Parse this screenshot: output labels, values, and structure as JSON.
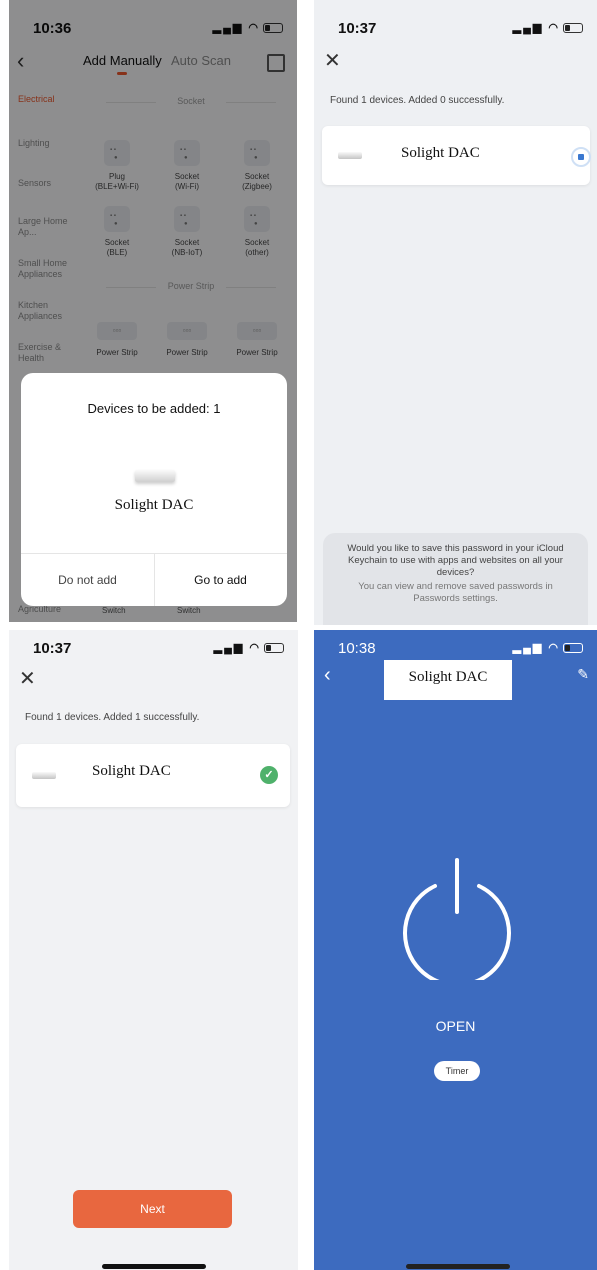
{
  "panel1": {
    "time": "10:36",
    "tabs": {
      "manual": "Add Manually",
      "auto": "Auto Scan"
    },
    "categories": [
      "Electrical",
      "Lighting",
      "Sensors",
      "Large Home Ap...",
      "Small Home Appliances",
      "Kitchen Appliances",
      "Exercise & Health",
      "Agriculture"
    ],
    "sections": {
      "socket": "Socket",
      "power_strip": "Power Strip"
    },
    "devices": [
      {
        "label": "Plug\n(BLE+Wi-Fi)"
      },
      {
        "label": "Socket\n(Wi-Fi)"
      },
      {
        "label": "Socket\n(Zigbee)"
      },
      {
        "label": "Socket\n(BLE)"
      },
      {
        "label": "Socket\n(NB-IoT)"
      },
      {
        "label": "Socket\n(other)"
      }
    ],
    "strips": [
      {
        "label": "Power Strip"
      },
      {
        "label": "Power Strip"
      },
      {
        "label": "Power Strip"
      }
    ],
    "bottom_labels": [
      "Switch",
      "Switch"
    ],
    "modal": {
      "title": "Devices to be added: 1",
      "device_name": "Solight DAC",
      "cancel": "Do not add",
      "confirm": "Go to add"
    }
  },
  "panel2": {
    "time": "10:37",
    "found": "Found 1 devices. Added 0 successfully.",
    "device_name": "Solight DAC",
    "keychain_prompt": "Would you like to save this password in your iCloud Keychain to use with apps and websites on all your devices?",
    "keychain_sub": "You can view and remove saved passwords in Passwords settings."
  },
  "panel3": {
    "time": "10:37",
    "found": "Found 1 devices. Added 1 successfully.",
    "device_name": "Solight DAC",
    "next": "Next"
  },
  "panel4": {
    "time": "10:38",
    "device_name": "Solight DAC",
    "state": "OPEN",
    "timer": "Timer"
  },
  "colors": {
    "accent": "#e8572e",
    "next_button": "#e8673f",
    "success": "#4fb16b",
    "control_bg": "#3d6bbf"
  },
  "icons": [
    "back-icon",
    "scan-icon",
    "close-icon",
    "check-icon",
    "edit-icon",
    "power-icon",
    "battery-icon",
    "wifi-icon",
    "signal-icon"
  ]
}
